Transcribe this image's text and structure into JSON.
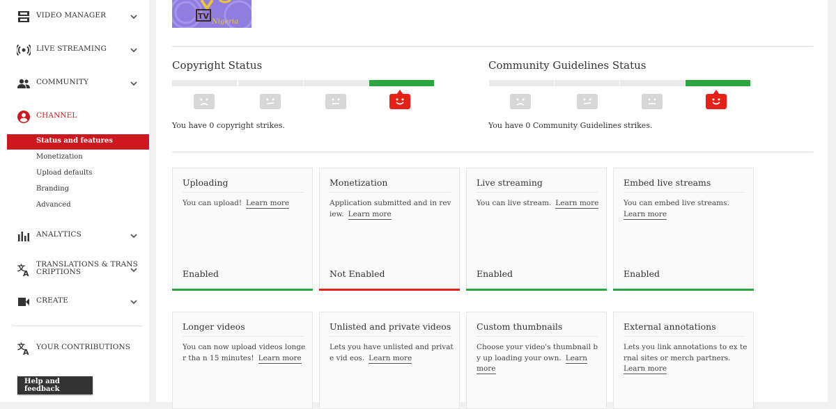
{
  "sidebar": {
    "items": [
      {
        "label": "VIDEO MANAGER",
        "icon": "video-manager-icon"
      },
      {
        "label": "LIVE STREAMING",
        "icon": "live-streaming-icon"
      },
      {
        "label": "COMMUNITY",
        "icon": "community-icon"
      },
      {
        "label": "CHANNEL",
        "icon": "channel-icon"
      },
      {
        "label": "ANALYTICS",
        "icon": "analytics-icon"
      },
      {
        "label": "TRANSLATIONS & TRANS\nCRIPTIONS",
        "icon": "translate-icon"
      },
      {
        "label": "CREATE",
        "icon": "create-icon"
      }
    ],
    "channel_subitems": [
      "Status and features",
      "Monetization",
      "Upload defaults",
      "Branding",
      "Advanced"
    ],
    "contributions_label": "YOUR CONTRIBUTIONS",
    "help_label": "Help and feedback",
    "accent_color": "#cc181e"
  },
  "logo": {
    "text": "TV",
    "subtext": "Nigeria"
  },
  "copyright": {
    "title": "Copyright Status",
    "strike_text": "You have 0 copyright strikes."
  },
  "community": {
    "title": "Community Guidelines Status",
    "strike_text": "You have 0 Community Guidelines strikes."
  },
  "features": [
    {
      "title": "Uploading",
      "desc": "You can upload!",
      "learn": "Learn more",
      "status": "Enabled",
      "color": "#2ba640"
    },
    {
      "title": "Monetization",
      "desc": "Application submitted and in rev iew.",
      "learn": "Learn more",
      "status": "Not Enabled",
      "color": "#e62117"
    },
    {
      "title": "Live streaming",
      "desc": "You can live stream.",
      "learn": "Learn more",
      "status": "Enabled",
      "color": "#2ba640"
    },
    {
      "title": "Embed live streams",
      "desc": "You can embed live streams.",
      "learn": "Learn more",
      "status": "Enabled",
      "color": "#2ba640"
    },
    {
      "title": "Longer videos",
      "desc": "You can now upload videos longer tha n 15 minutes!",
      "learn": "Learn more",
      "status": "",
      "color": ""
    },
    {
      "title": "Unlisted and private videos",
      "desc": "Lets you have unlisted and private vid eos.",
      "learn": "Learn more",
      "status": "",
      "color": ""
    },
    {
      "title": "Custom thumbnails",
      "desc": "Choose your video's thumbnail by up loading your own.",
      "learn": "Learn more",
      "status": "",
      "color": ""
    },
    {
      "title": "External annotations",
      "desc": "Lets you link annotations to ex ternal sites or merch partners.",
      "learn": "Learn more",
      "status": "",
      "color": ""
    }
  ]
}
